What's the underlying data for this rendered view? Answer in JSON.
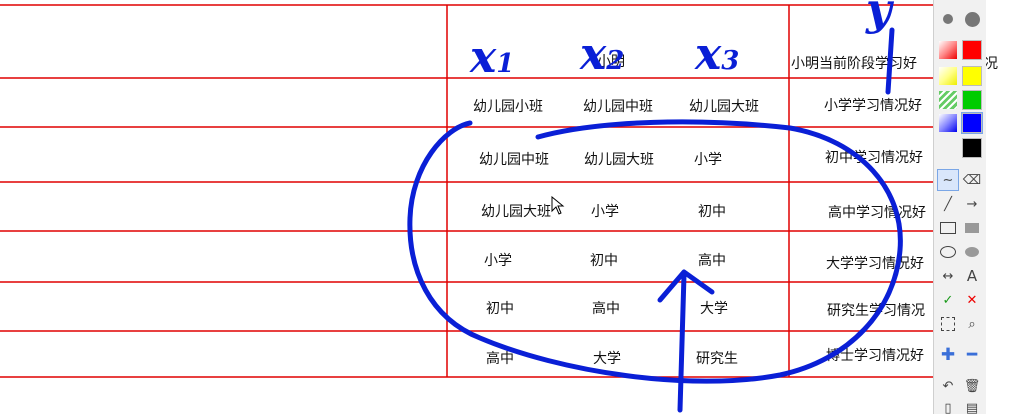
{
  "table": {
    "header": {
      "col3": "小明当前阶段学习好",
      "col3_tail": "况",
      "col1_partial": "小明"
    },
    "rows": [
      {
        "x1": "幼儿园小班",
        "x2": "幼儿园中班",
        "x3": "幼儿园大班",
        "y": "小学学习情况好"
      },
      {
        "x1": "幼儿园中班",
        "x2": "幼儿园大班",
        "x3": "小学",
        "y": "初中学习情况好"
      },
      {
        "x1": "幼儿园大班",
        "x2": "小学",
        "x3": "初中",
        "y": "高中学习情况好"
      },
      {
        "x1": "小学",
        "x2": "初中",
        "x3": "高中",
        "y": "大学学习情况好"
      },
      {
        "x1": "初中",
        "x2": "高中",
        "x3": "大学",
        "y": "研究生学习情况"
      },
      {
        "x1": "高中",
        "x2": "大学",
        "x3": "研究生",
        "y": "博士学习情况好"
      }
    ]
  },
  "annotations": {
    "x1": "x",
    "x1_sub": "1",
    "x2": "x",
    "x2_sub": "2",
    "x3": "x",
    "x3_sub": "3",
    "y": "y",
    "ink_color": "#0a1fd6"
  },
  "palette": {
    "colors": [
      "#ff0000",
      "#ffff00",
      "#00cc00",
      "#0000ff",
      "#000000"
    ],
    "tools": [
      "pen-icon",
      "eraser-icon",
      "line-icon",
      "arrow-icon",
      "rectangle-icon",
      "filled-rectangle-icon",
      "ellipse-icon",
      "filled-ellipse-icon",
      "double-arrow-icon",
      "text-icon",
      "check-icon",
      "delete-icon",
      "select-icon",
      "zoom-icon",
      "plus-icon",
      "minus-icon",
      "undo-icon",
      "trash-icon"
    ],
    "text_tool_label": "A"
  },
  "grid_color": "#e00000"
}
